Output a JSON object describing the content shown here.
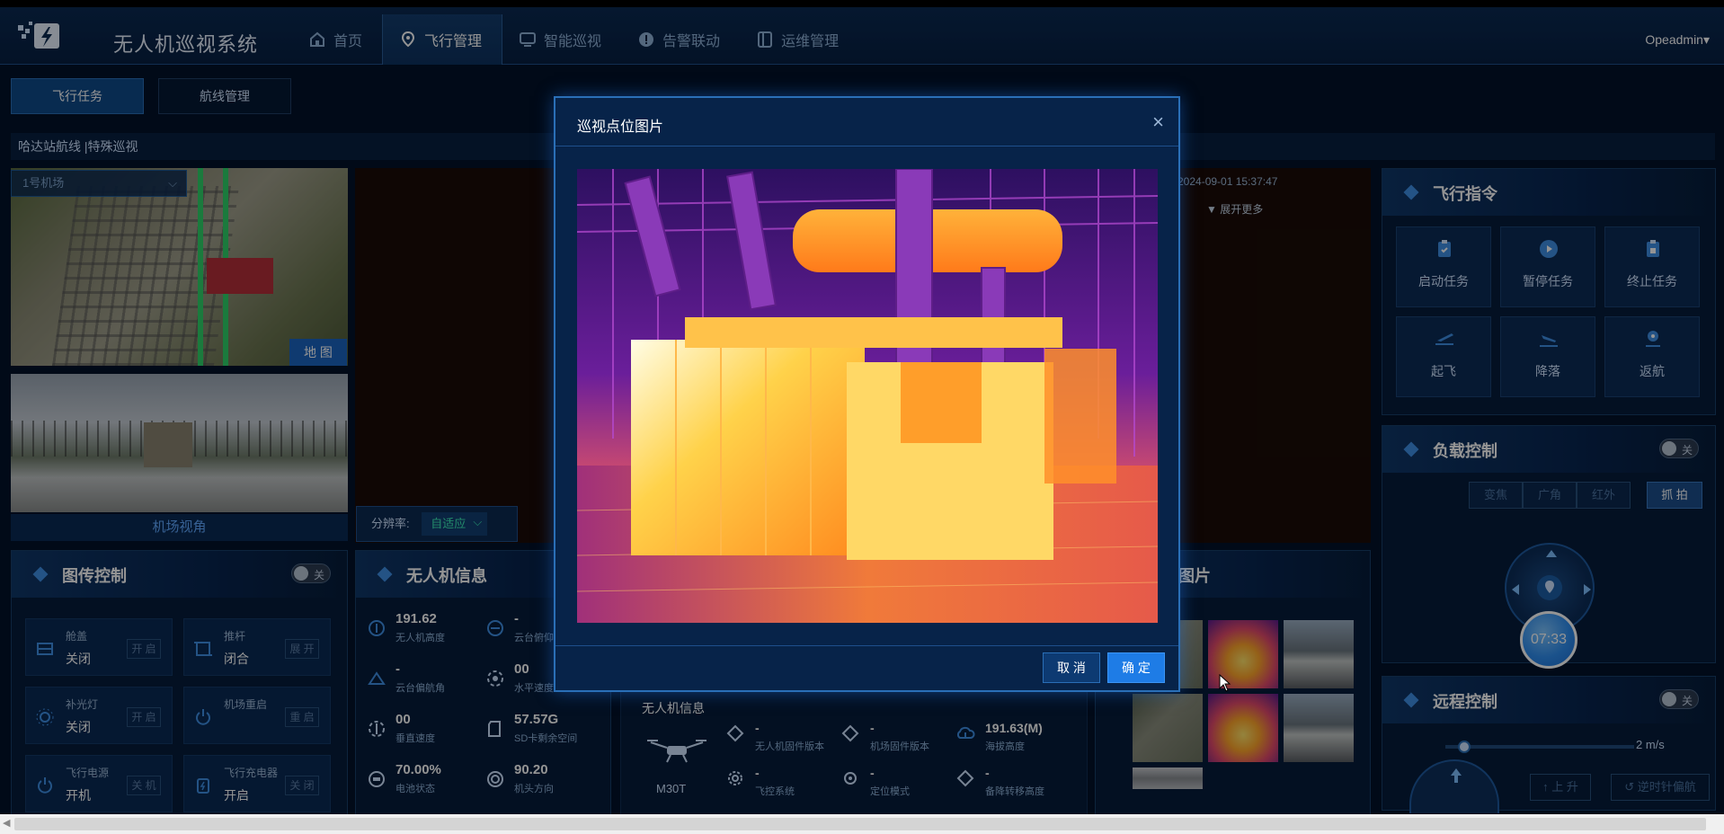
{
  "app": {
    "title": "无人机巡视系统",
    "user": "Opeadmin▾",
    "nav": [
      {
        "label": "首页",
        "icon": "home-icon"
      },
      {
        "label": "飞行管理",
        "icon": "location-pin-icon",
        "active": true
      },
      {
        "label": "智能巡视",
        "icon": "monitor-icon"
      },
      {
        "label": "告警联动",
        "icon": "alert-icon"
      },
      {
        "label": "运维管理",
        "icon": "book-icon"
      }
    ]
  },
  "subtabs": [
    {
      "label": "飞行任务",
      "active": true
    },
    {
      "label": "航线管理",
      "active": false
    }
  ],
  "route_name": "哈达站航线 |特殊巡视",
  "left": {
    "airport_select": "1号机场",
    "map_button": "地 图",
    "view_label": "机场视角"
  },
  "video": {
    "resolution_label": "分辨率:",
    "resolution_value": "自适应",
    "timestamp": "2024-09-01 15:37:47",
    "expand_more": "展开更多"
  },
  "image_control": {
    "title": "图传控制",
    "toggle": "关",
    "items": [
      {
        "name": "舱盖",
        "state": "关闭",
        "action": "开 启",
        "icon": "hatch-icon"
      },
      {
        "name": "推杆",
        "state": "闭合",
        "action": "展 开",
        "icon": "pusher-icon"
      },
      {
        "name": "补光灯",
        "state": "关闭",
        "action": "开 启",
        "icon": "light-icon"
      },
      {
        "name": "机场重启",
        "state": "",
        "action": "重 启",
        "icon": "power-icon"
      },
      {
        "name": "飞行电源",
        "state": "开机",
        "action": "关 机",
        "icon": "power-icon"
      },
      {
        "name": "飞行充电器",
        "state": "开启",
        "action": "关 闭",
        "icon": "charger-icon"
      }
    ]
  },
  "drone_panel": {
    "title": "无人机信息",
    "stats": [
      {
        "value": "191.62",
        "label": "无人机高度",
        "icon": "altitude-icon"
      },
      {
        "value": "-",
        "label": "云台俯仰角",
        "icon": "gimbal-pitch-icon"
      },
      {
        "value": "-",
        "label": "云台偏航角",
        "icon": "gimbal-yaw-icon"
      },
      {
        "value": "00",
        "label": "水平速度",
        "icon": "speed-icon"
      },
      {
        "value": "00",
        "label": "垂直速度",
        "icon": "vspeed-icon"
      },
      {
        "value": "57.57G",
        "label": "SD卡剩余空间",
        "icon": "sd-card-icon"
      },
      {
        "value": "70.00%",
        "label": "电池状态",
        "icon": "battery-icon"
      },
      {
        "value": "90.20",
        "label": "机头方向",
        "icon": "heading-icon"
      }
    ]
  },
  "drone_info": {
    "title": "无人机信息",
    "model": "M30T",
    "fields": [
      {
        "value": "-",
        "label": "无人机固件版本",
        "icon": "firmware-icon"
      },
      {
        "value": "-",
        "label": "机场固件版本",
        "icon": "dock-firmware-icon"
      },
      {
        "value": "191.63(M)",
        "label": "海拔高度",
        "icon": "cloud-upload-icon"
      },
      {
        "value": "-",
        "label": "飞控系统",
        "icon": "gear-icon"
      },
      {
        "value": "-",
        "label": "定位模式",
        "icon": "locate-icon"
      },
      {
        "value": "-",
        "label": "备降转移高度",
        "icon": "transfer-icon"
      }
    ]
  },
  "gallery": {
    "title": "视频图片"
  },
  "flight_cmd": {
    "title": "飞行指令",
    "buttons": [
      {
        "label": "启动任务",
        "icon": "clipboard-start-icon"
      },
      {
        "label": "暂停任务",
        "icon": "pause-icon"
      },
      {
        "label": "终止任务",
        "icon": "clipboard-stop-icon"
      },
      {
        "label": "起飞",
        "icon": "takeoff-icon"
      },
      {
        "label": "降落",
        "icon": "landing-icon"
      },
      {
        "label": "返航",
        "icon": "return-home-icon"
      }
    ]
  },
  "payload": {
    "title": "负载控制",
    "toggle": "关",
    "modes": [
      "变焦",
      "广角",
      "红外"
    ],
    "shoot": "抓 拍",
    "timer": "07:33"
  },
  "remote": {
    "title": "远程控制",
    "toggle": "关",
    "speed": "2 m/s",
    "up": "上 升",
    "rotate": "逆时针偏航"
  },
  "modal": {
    "title": "巡视点位图片",
    "cancel": "取 消",
    "ok": "确 定"
  },
  "colors": {
    "accent": "#1e7ce6",
    "bg": "#03122a",
    "panel": "#061d3b",
    "teal": "#3df0b9"
  }
}
